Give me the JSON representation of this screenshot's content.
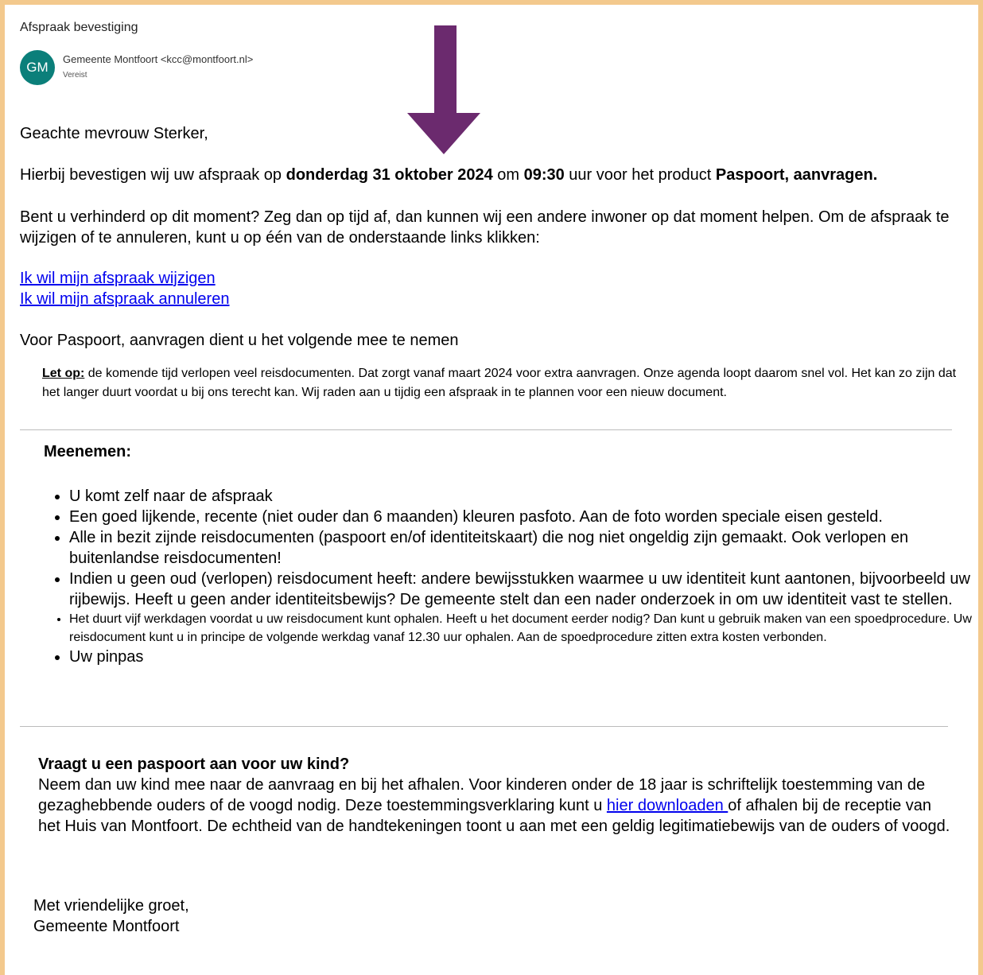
{
  "email": {
    "subject": "Afspraak bevestiging",
    "avatar_initials": "GM",
    "sender": "Gemeente Montfoort <kcc@montfoort.nl>",
    "sender_note": "Vereist"
  },
  "body": {
    "greeting": "Geachte mevrouw Sterker,",
    "confirm_1": "Hierbij bevestigen wij uw afspraak op ",
    "confirm_date": "donderdag 31 oktober 2024",
    "confirm_2": " om ",
    "confirm_time": "09:30",
    "confirm_3": " uur voor het product ",
    "confirm_product": "Paspoort, aanvragen.",
    "cancel_text": "Bent u verhinderd op dit moment? Zeg dan op tijd af, dan kunnen wij een andere inwoner op dat moment helpen. Om de afspraak te wijzigen of te annuleren, kunt u op één van de onderstaande links klikken:",
    "link_change": "Ik wil mijn afspraak wijzigen",
    "link_cancel": "Ik wil mijn afspraak annuleren",
    "bring_intro": "Voor Paspoort, aanvragen dient u het volgende mee te nemen",
    "note_label": "Let op:",
    "note_text": " de komende tijd verlopen veel reisdocumenten. Dat zorgt vanaf maart 2024 voor extra aanvragen. Onze agenda loopt daarom snel vol. Het kan zo zijn dat het langer duurt voordat u bij ons terecht kan. Wij raden aan u tijdig een afspraak in te plannen voor een nieuw document.",
    "bring_heading": "Meenemen:",
    "items": [
      "U komt zelf naar de afspraak",
      "Een goed lijkende, recente (niet ouder dan 6 maanden) kleuren pasfoto. Aan de foto worden speciale eisen gesteld.",
      "Alle in bezit zijnde reisdocumenten (paspoort en/of identiteitskaart) die nog niet ongeldig zijn gemaakt. Ook verlopen en buitenlandse reisdocumenten!",
      "Indien u geen oud (verlopen) reisdocument heeft: andere bewijsstukken waarmee u uw identiteit kunt aantonen, bijvoorbeeld uw rijbewijs. Heeft u geen ander identiteitsbewijs? De gemeente stelt dan een nader onderzoek in om uw identiteit vast te stellen.",
      "Het duurt vijf werkdagen voordat u uw reisdocument kunt ophalen. Heeft u het document eerder nodig? Dan kunt u gebruik maken van een spoedprocedure. Uw reisdocument kunt u in principe de volgende werkdag vanaf 12.30 uur ophalen. Aan de spoedprocedure zitten extra kosten verbonden.",
      "Uw pinpas"
    ],
    "child_heading": "Vraagt u een paspoort aan voor uw kind?",
    "child_text_1": "Neem dan uw kind mee naar de aanvraag en bij het afhalen. Voor kinderen onder de 18 jaar is schriftelijk toestemming van de gezaghebbende ouders of de voogd nodig. Deze toestemmingsverklaring kunt u ",
    "child_link": "hier downloaden ",
    "child_text_2": "of afhalen bij de receptie van het Huis van Montfoort. De echtheid van de handtekeningen toont u aan met een geldig legitimatiebewijs van de ouders of voogd.",
    "closing_1": "Met vriendelijke groet,",
    "closing_2": "Gemeente Montfoort"
  },
  "colors": {
    "frame": "#f3c98d",
    "arrow": "#6b2a6e",
    "avatar": "#0b7f7a",
    "link": "#0000ee"
  }
}
